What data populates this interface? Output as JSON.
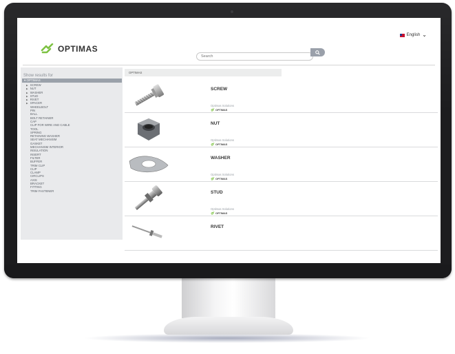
{
  "header": {
    "brand": "OPTIMAS",
    "language": "English",
    "search_placeholder": "Search"
  },
  "sidebar": {
    "title": "Show results for",
    "root": "OPTIMAS",
    "items": [
      {
        "label": "SCREW",
        "expandable": true
      },
      {
        "label": "NUT",
        "expandable": true
      },
      {
        "label": "WASHER",
        "expandable": true
      },
      {
        "label": "STUD",
        "expandable": true
      },
      {
        "label": "RIVET",
        "expandable": true
      },
      {
        "label": "SPACER",
        "expandable": true
      },
      {
        "label": "WHEELBOLT",
        "expandable": false
      },
      {
        "label": "PIN",
        "expandable": false
      },
      {
        "label": "BALL",
        "expandable": false
      },
      {
        "label": "BOLT RETAINER",
        "expandable": false
      },
      {
        "label": "CAP",
        "expandable": false
      },
      {
        "label": "CLIP FOR WIRE AND CABLE",
        "expandable": false
      },
      {
        "label": "TOOL",
        "expandable": false
      },
      {
        "label": "SPRING",
        "expandable": false
      },
      {
        "label": "RETAINING WASHER",
        "expandable": false
      },
      {
        "label": "SEAT MECHANISM",
        "expandable": false
      },
      {
        "label": "GASKET",
        "expandable": false
      },
      {
        "label": "MECHANISM INTERIOR",
        "expandable": false
      },
      {
        "label": "INSULATION",
        "expandable": false
      },
      {
        "label": "INSERT",
        "expandable": false
      },
      {
        "label": "FILTER",
        "expandable": false
      },
      {
        "label": "BUFFER",
        "expandable": false
      },
      {
        "label": "TRIM CLIP",
        "expandable": false
      },
      {
        "label": "CLIP",
        "expandable": false
      },
      {
        "label": "CLAMP",
        "expandable": false
      },
      {
        "label": "CIRCLIPS",
        "expandable": false
      },
      {
        "label": "AXIS",
        "expandable": false
      },
      {
        "label": "BRACKET",
        "expandable": false
      },
      {
        "label": "FITTING",
        "expandable": false
      },
      {
        "label": "TRIM FASTENER",
        "expandable": false
      }
    ]
  },
  "breadcrumb": "OPTIMAS",
  "results": [
    {
      "name": "SCREW",
      "source": "Optimas Solutions",
      "logo": "OPTIMAS",
      "icon": "screw-image"
    },
    {
      "name": "NUT",
      "source": "Optimas Solutions",
      "logo": "OPTIMAS",
      "icon": "nut-image"
    },
    {
      "name": "WASHER",
      "source": "Optimas Solutions",
      "logo": "OPTIMAS",
      "icon": "washer-image"
    },
    {
      "name": "STUD",
      "source": "Optimas Solutions",
      "logo": "OPTIMAS",
      "icon": "stud-image"
    },
    {
      "name": "RIVET",
      "source": "",
      "logo": "",
      "icon": "rivet-image"
    }
  ],
  "colors": {
    "brand_green": "#7dc242",
    "sidebar_bg": "#e9eaec",
    "sidebar_selected": "#9aa1aa",
    "bezel": "#1c1c1e"
  }
}
